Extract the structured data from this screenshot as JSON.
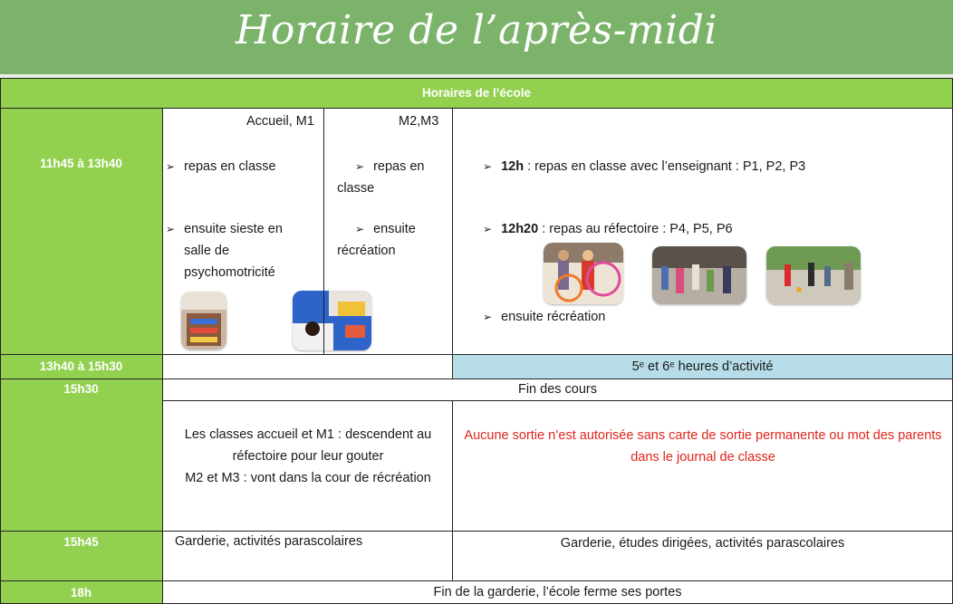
{
  "banner": {
    "title": "Horaire de l’après-midi"
  },
  "table": {
    "header": "Horaires de l’école",
    "rows": [
      {
        "time": "11h45 à 13h40"
      },
      {
        "time": "13h40 à 15h30"
      },
      {
        "time": "15h30"
      },
      {
        "time": "15h45"
      },
      {
        "time": "18h"
      }
    ],
    "col_a_title": "Accueil, M1",
    "col_b_title": "M2,M3",
    "col_a_items": [
      "repas en classe",
      "ensuite sieste en salle de psychomotricité"
    ],
    "col_b_items": [
      "repas en classe",
      "ensuite récréation"
    ],
    "primary": {
      "item1_bold": "12h",
      "item1_text": " : repas en classe avec l’enseignant : P1, P2, P3",
      "item2_bold": "12h20",
      "item2_text": " : repas au réfectoire : P4, P5, P6",
      "item3_text": "ensuite récréation"
    },
    "activity_hours": "5ᵉ et 6ᵉ heures d’activité",
    "end_of_classes": "Fin des cours",
    "snack_note_1": "Les classes accueil et M1 : descendent au réfectoire pour leur gouter",
    "snack_note_2": "M2 et M3 : vont dans la cour de récréation",
    "exit_warning": "Aucune sortie n’est autorisée sans carte de sortie permanente ou mot des parents dans le journal de classe",
    "garderie_maternelle": "Garderie, activités parascolaires",
    "garderie_primaire": "Garderie, études dirigées, activités parascolaires",
    "closing": "Fin de la garderie, l’école ferme ses portes"
  }
}
